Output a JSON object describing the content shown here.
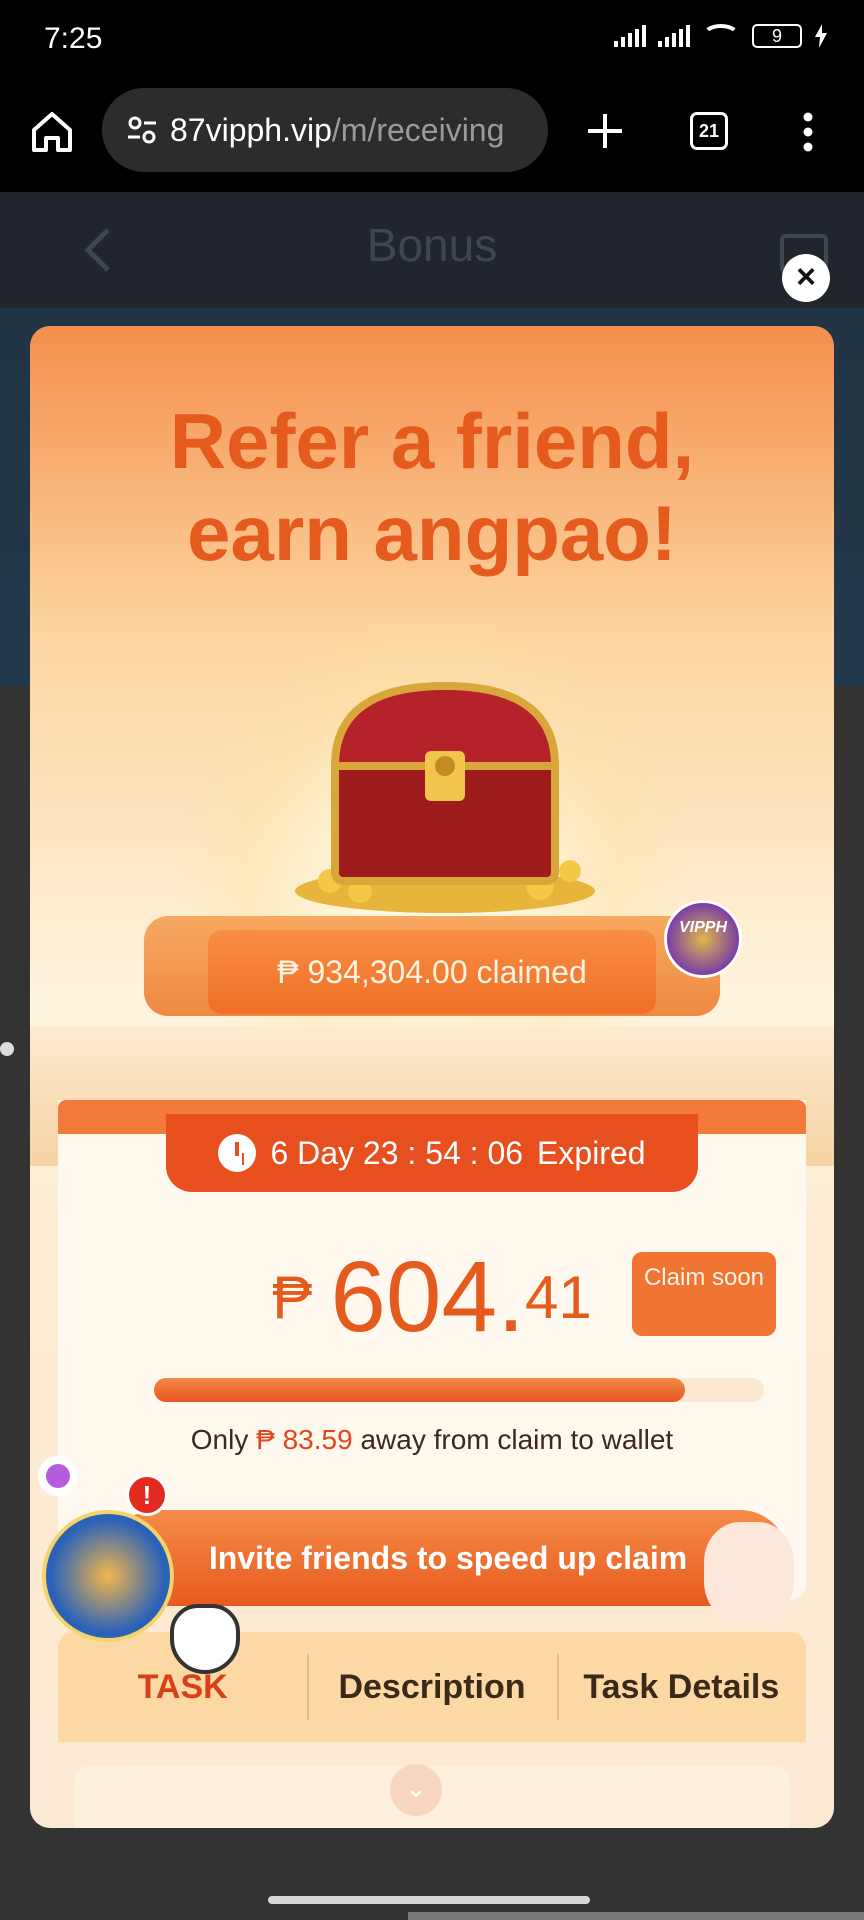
{
  "status_bar": {
    "time": "7:25",
    "battery": "9"
  },
  "browser": {
    "url_host": "87vipph.vip",
    "url_path": "/m/receiving",
    "tab_count": "21"
  },
  "page": {
    "title": "Bonus"
  },
  "promo": {
    "headline_line1": "Refer a friend,",
    "headline_line2": "earn angpao!",
    "claimed_total": "₱ 934,304.00 claimed",
    "timer": "6 Day 23 : 54 : 06",
    "timer_status": "Expired",
    "amount_currency": "₱",
    "amount_int": "604.",
    "amount_dec": "41",
    "claim_button": "Claim soon",
    "vip_badge": "VIPPH",
    "progress_percent": 87,
    "note_prefix": "Only",
    "note_amount": "₱ 83.59",
    "note_suffix": "away from claim to wallet",
    "invite_button": "Invite friends to speed up claim",
    "alert_mark": "!"
  },
  "tabs": [
    {
      "label": "TASK",
      "active": true
    },
    {
      "label": "Description",
      "active": false
    },
    {
      "label": "Task Details",
      "active": false
    }
  ],
  "colors": {
    "accent": "#e55a1d",
    "brand_orange": "#f07532"
  }
}
